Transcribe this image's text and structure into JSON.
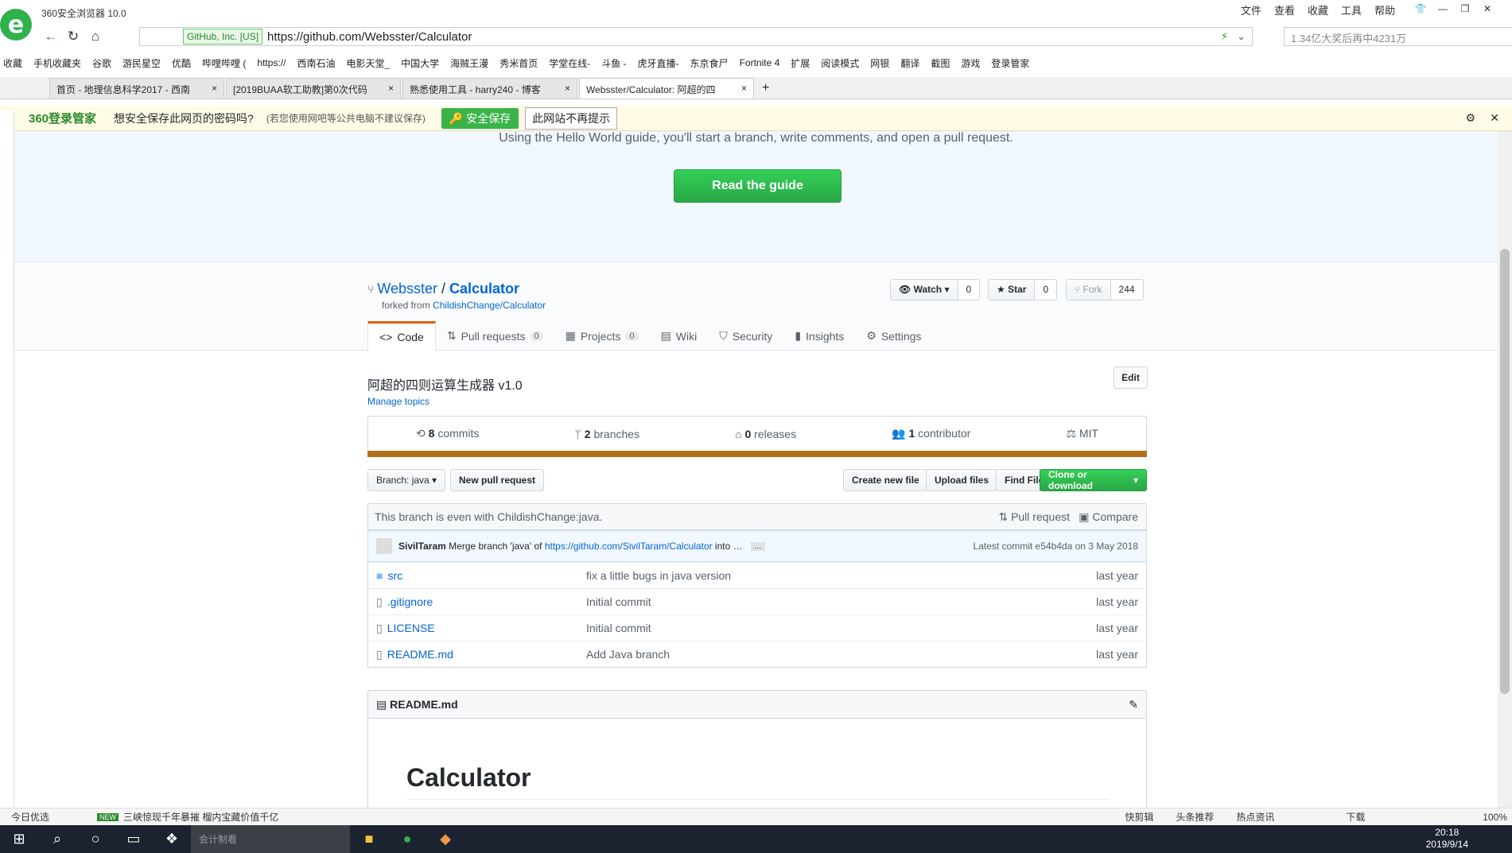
{
  "browser": {
    "app_name": "360安全浏览器 10.0",
    "menu": [
      "文件",
      "查看",
      "收藏",
      "工具",
      "帮助"
    ],
    "ssl_label": "GitHub, Inc. [US]",
    "url": "https://github.com/Websster/Calculator",
    "search_placeholder": "1.34亿大奖后再中4231万",
    "bookmarks": [
      "收藏",
      "手机收藏夹",
      "谷歌",
      "游民星空",
      "优酷",
      "哔哩哔哩 (",
      "https://",
      "西南石油",
      "电影天堂_",
      "中国大学",
      "海贼王漫",
      "秀米首页",
      "学堂在线-",
      "斗鱼 -",
      "虎牙直播-",
      "东京食尸",
      "Fortnite 4",
      "扩展",
      "阅读模式",
      "网银",
      "翻译",
      "截图",
      "游戏",
      "登录管家"
    ],
    "tabs": [
      {
        "label": "首页 - 地理信息科学2017 - 西南"
      },
      {
        "label": "[2019BUAA软工助教]第0次代码"
      },
      {
        "label": "熟悉使用工具 - harry240 - 博客"
      },
      {
        "label": "Websster/Calculator: 阿超的四"
      }
    ],
    "password_bar": {
      "brand": "360登录管家",
      "question": "想安全保存此网页的密码吗?",
      "hint": "(若您使用网吧等公共电脑不建议保存)",
      "save": "安全保存",
      "never": "此网站不再提示"
    }
  },
  "hero": {
    "text": "Using the Hello World guide, you'll start a branch, write comments, and open a pull request.",
    "button": "Read the guide"
  },
  "repo": {
    "owner": "Websster",
    "name": "Calculator",
    "forked_label": "forked from",
    "forked_from": "ChildishChange/Calculator",
    "watch": {
      "label": "Watch",
      "count": "0"
    },
    "star": {
      "label": "Star",
      "count": "0"
    },
    "fork": {
      "label": "Fork",
      "count": "244"
    },
    "nav": [
      {
        "label": "Code"
      },
      {
        "label": "Pull requests",
        "count": "0"
      },
      {
        "label": "Projects",
        "count": "0"
      },
      {
        "label": "Wiki"
      },
      {
        "label": "Security"
      },
      {
        "label": "Insights"
      },
      {
        "label": "Settings"
      }
    ],
    "description": "阿超的四则运算生成器 v1.0",
    "edit": "Edit",
    "manage_topics": "Manage topics",
    "summary": {
      "commits_n": "8",
      "commits": "commits",
      "branches_n": "2",
      "branches": "branches",
      "releases_n": "0",
      "releases": "releases",
      "contributors_n": "1",
      "contributors": "contributor",
      "license": "MIT"
    },
    "branch_select": "Branch: java",
    "new_pr": "New pull request",
    "create_file": "Create new file",
    "upload": "Upload files",
    "find": "Find File",
    "clone": "Clone or download",
    "compare_text": "This branch is even with ChildishChange:java.",
    "pull_request": "Pull request",
    "compare": "Compare",
    "commit": {
      "author": "SivilTaram",
      "msg_pre": "Merge branch 'java' of",
      "link": "https://github.com/SivilTaram/Calculator",
      "msg_post": "into …",
      "latest": "Latest commit e54b4da on 3 May 2018"
    },
    "files": [
      {
        "name": "src",
        "type": "dir",
        "msg": "fix a little bugs in java version",
        "age": "last year"
      },
      {
        "name": ".gitignore",
        "type": "file",
        "msg": "Initial commit",
        "age": "last year"
      },
      {
        "name": "LICENSE",
        "type": "file",
        "msg": "Initial commit",
        "age": "last year"
      },
      {
        "name": "README.md",
        "type": "file",
        "msg": "Add Java branch",
        "age": "last year"
      }
    ],
    "readme_label": "README.md",
    "readme_title": "Calculator"
  },
  "status": {
    "left": "今日优选",
    "news": "三峡惊现千年暴摧 榴内宝藏价值千亿",
    "items": [
      "快剪辑",
      "头条推荐",
      "热点资讯",
      "下载"
    ],
    "zoom": "100%"
  },
  "taskbar": {
    "search_placeholder": "会计制看",
    "time": "20:18",
    "date": "2019/9/14"
  },
  "colors": {
    "accent_green": "#28a745",
    "link": "#0366d6",
    "java": "#b07219"
  }
}
